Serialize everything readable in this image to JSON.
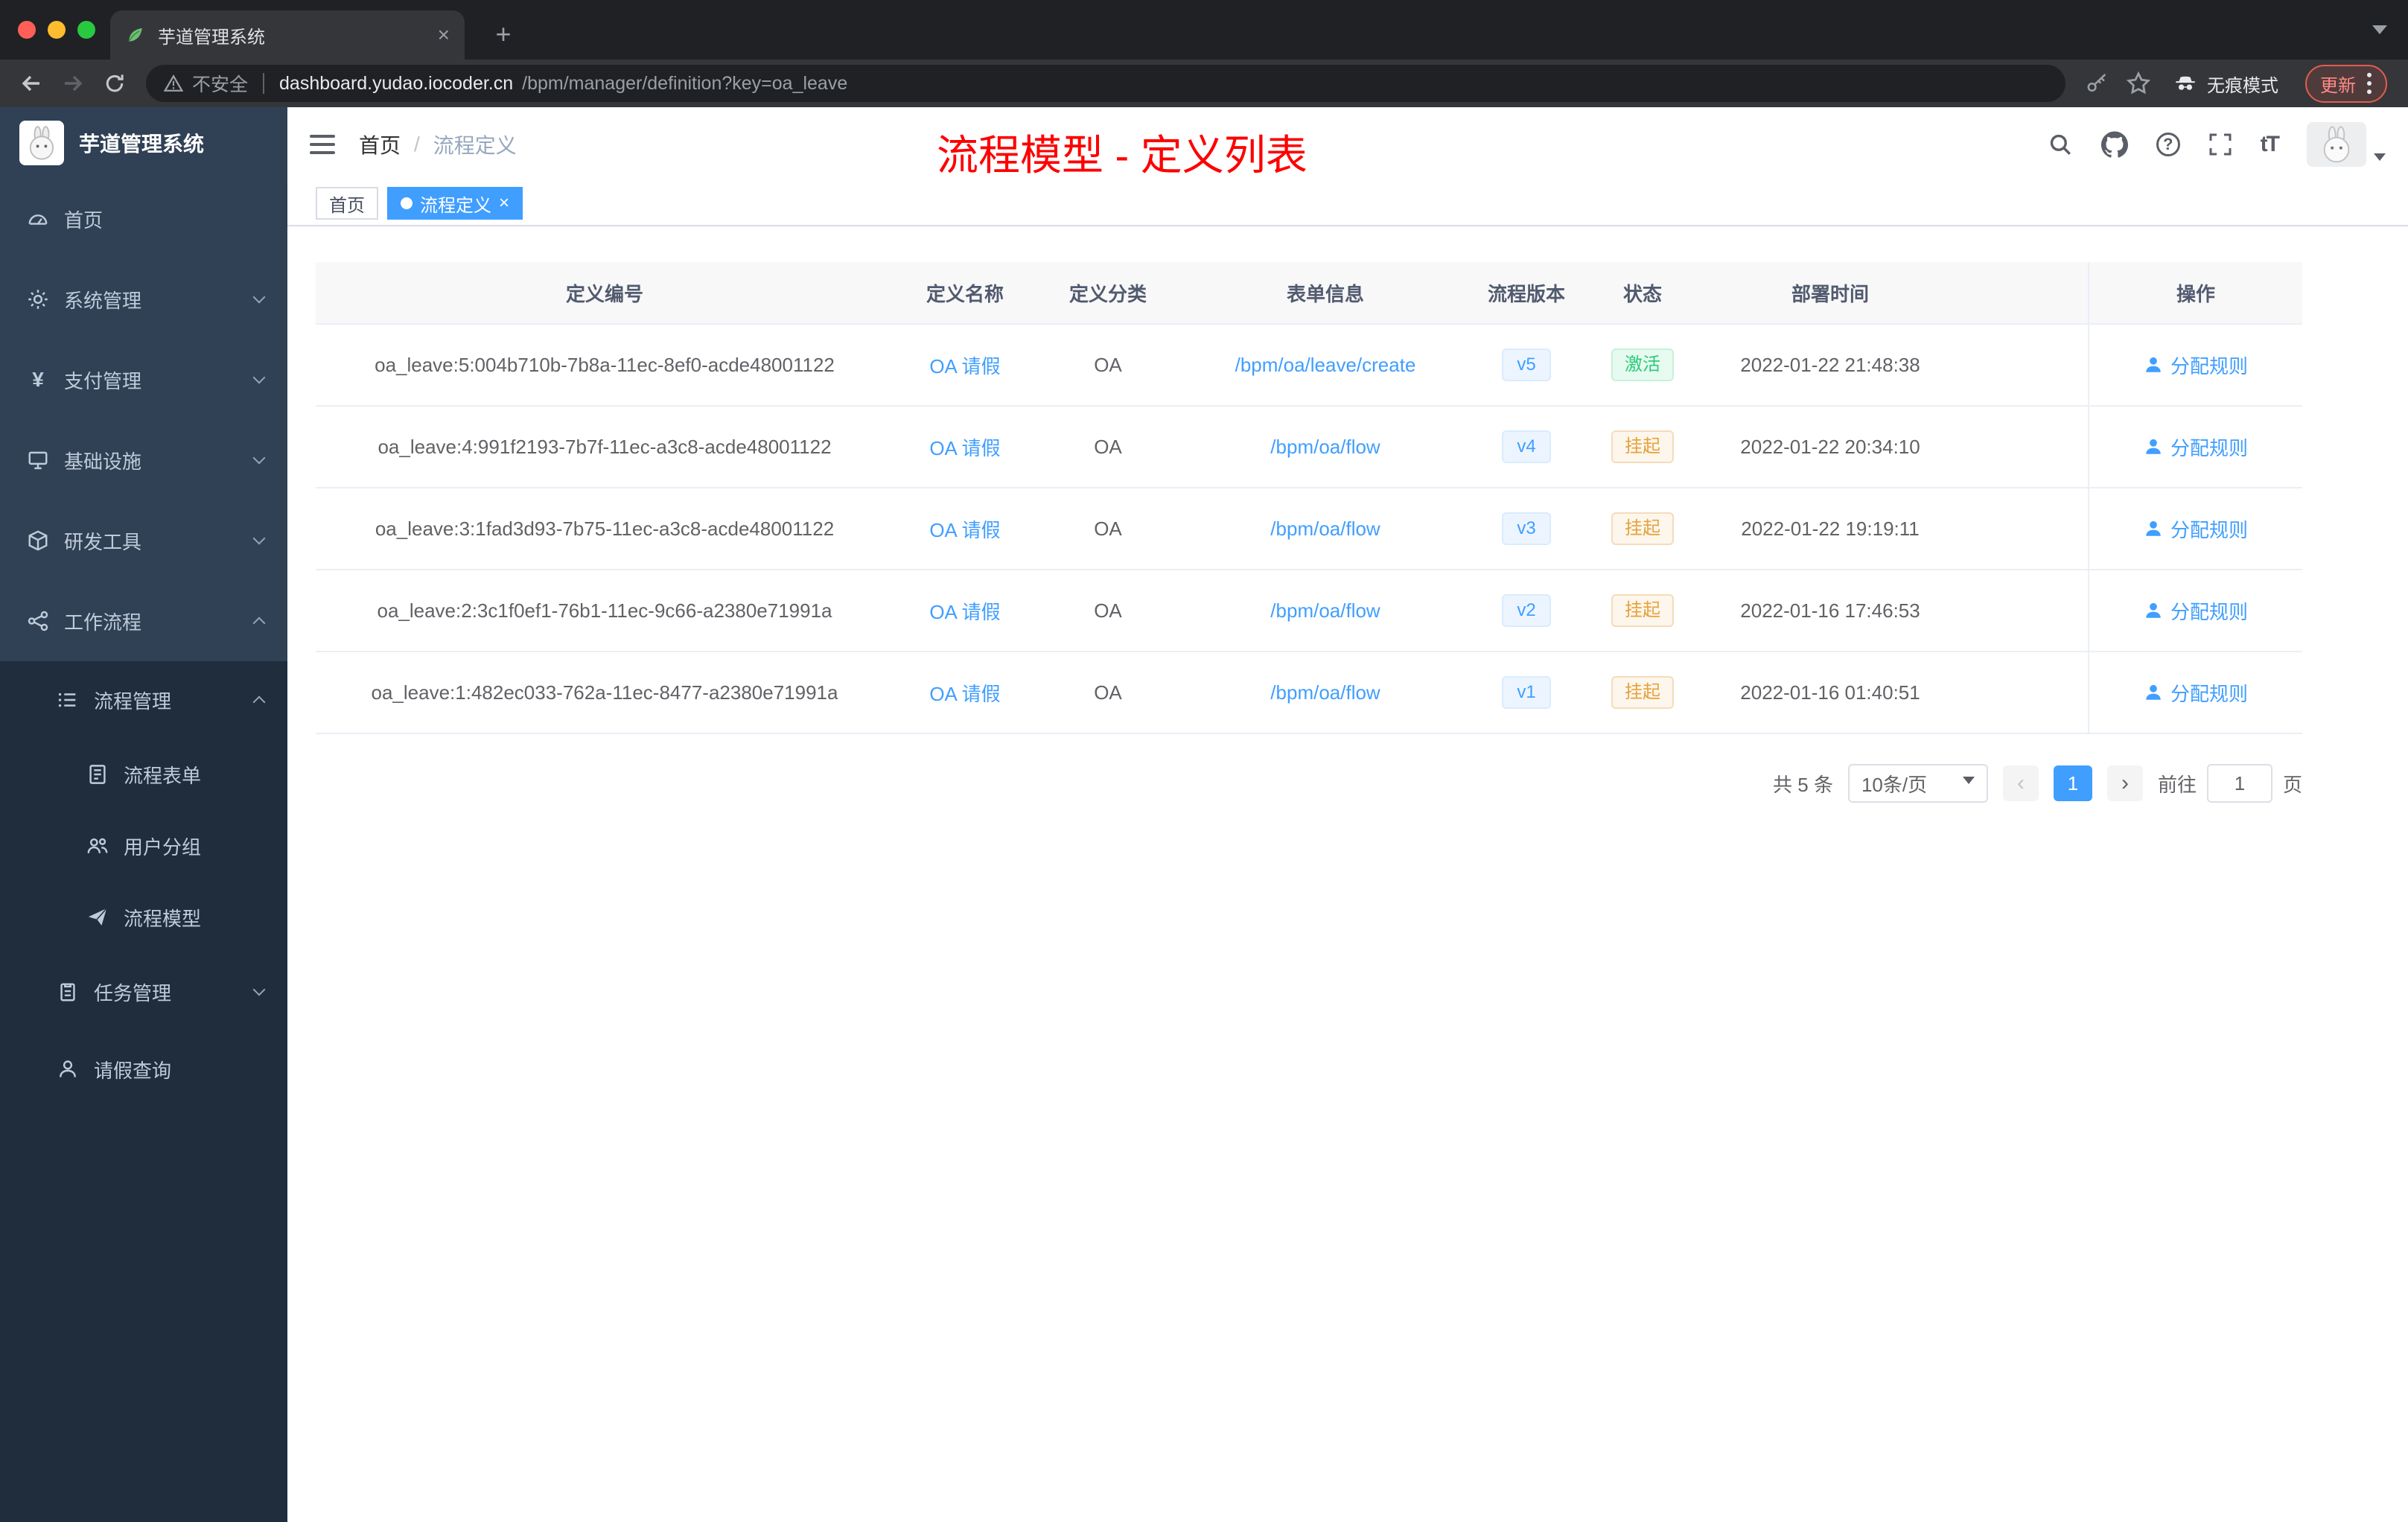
{
  "browser": {
    "tab_title": "芋道管理系统",
    "close_icon": "×",
    "new_tab_icon": "+",
    "security_label": "不安全",
    "url_host": "dashboard.yudao.iocoder.cn",
    "url_path": "/bpm/manager/definition?key=oa_leave",
    "incognito_label": "无痕模式",
    "update_label": "更新"
  },
  "sidebar": {
    "logo_title": "芋道管理系统",
    "items": [
      {
        "label": "首页"
      },
      {
        "label": "系统管理"
      },
      {
        "label": "支付管理"
      },
      {
        "label": "基础设施"
      },
      {
        "label": "研发工具"
      },
      {
        "label": "工作流程"
      }
    ],
    "process_group": {
      "label": "流程管理",
      "children": [
        {
          "label": "流程表单"
        },
        {
          "label": "用户分组"
        },
        {
          "label": "流程模型"
        }
      ]
    },
    "task_group": {
      "label": "任务管理"
    },
    "leave_item": {
      "label": "请假查询"
    }
  },
  "header": {
    "breadcrumb": [
      "首页",
      "流程定义"
    ],
    "breadcrumb_separator": "/",
    "annotation": "流程模型 - 定义列表",
    "font_icon_text": "tT"
  },
  "tags": [
    {
      "label": "首页",
      "active": false
    },
    {
      "label": "流程定义",
      "active": true
    }
  ],
  "table": {
    "columns": [
      "定义编号",
      "定义名称",
      "定义分类",
      "表单信息",
      "流程版本",
      "状态",
      "部署时间",
      "操作"
    ],
    "rows": [
      {
        "id": "oa_leave:5:004b710b-7b8a-11ec-8ef0-acde48001122",
        "name": "OA 请假",
        "category": "OA",
        "form": "/bpm/oa/leave/create",
        "version": "v5",
        "status": "激活",
        "status_type": "success",
        "time": "2022-01-22 21:48:38",
        "action": "分配规则"
      },
      {
        "id": "oa_leave:4:991f2193-7b7f-11ec-a3c8-acde48001122",
        "name": "OA 请假",
        "category": "OA",
        "form": "/bpm/oa/flow",
        "version": "v4",
        "status": "挂起",
        "status_type": "warning",
        "time": "2022-01-22 20:34:10",
        "action": "分配规则"
      },
      {
        "id": "oa_leave:3:1fad3d93-7b75-11ec-a3c8-acde48001122",
        "name": "OA 请假",
        "category": "OA",
        "form": "/bpm/oa/flow",
        "version": "v3",
        "status": "挂起",
        "status_type": "warning",
        "time": "2022-01-22 19:19:11",
        "action": "分配规则"
      },
      {
        "id": "oa_leave:2:3c1f0ef1-76b1-11ec-9c66-a2380e71991a",
        "name": "OA 请假",
        "category": "OA",
        "form": "/bpm/oa/flow",
        "version": "v2",
        "status": "挂起",
        "status_type": "warning",
        "time": "2022-01-16 17:46:53",
        "action": "分配规则"
      },
      {
        "id": "oa_leave:1:482ec033-762a-11ec-8477-a2380e71991a",
        "name": "OA 请假",
        "category": "OA",
        "form": "/bpm/oa/flow",
        "version": "v1",
        "status": "挂起",
        "status_type": "warning",
        "time": "2022-01-16 01:40:51",
        "action": "分配规则"
      }
    ]
  },
  "pagination": {
    "total": "共 5 条",
    "page_size": "10条/页",
    "prev": "‹",
    "current": "1",
    "next": "›",
    "goto_prefix": "前往",
    "goto_value": "1",
    "goto_suffix": "页"
  },
  "colors": {
    "accent_blue": "#409eff",
    "success_green": "#29cc7a",
    "warning_orange": "#e6a23c",
    "annotation_red": "#fe0000",
    "sidebar_bg": "#304156",
    "sidebar_sub_bg": "#1f2d3d",
    "active_tag_bg": "#409eff"
  }
}
